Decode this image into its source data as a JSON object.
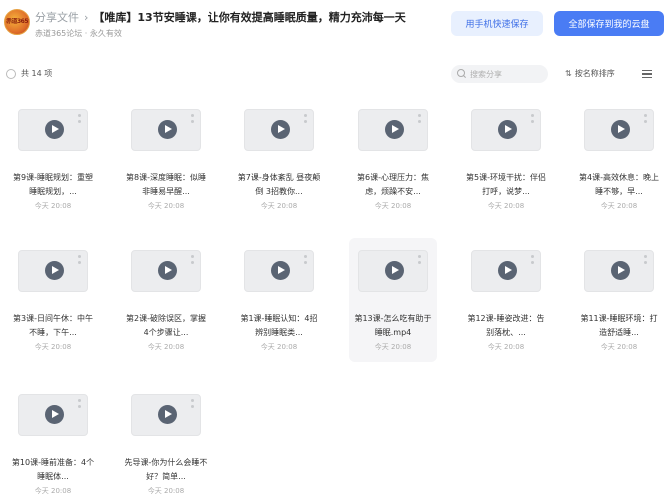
{
  "header": {
    "avatar_text": "赤道365论坛",
    "breadcrumb_root": "分享文件",
    "breadcrumb_sep": "›",
    "title": "【唯库】13节安睡课，让你有效提高睡眠质量，精力充沛每一天",
    "meta": "赤道365论坛 · 永久有效",
    "phone_save_label": "用手机快速保存",
    "save_all_label": "全部保存到我的云盘"
  },
  "toolbar": {
    "count": "共 14 项",
    "search_placeholder": "搜索分享",
    "sort_icon": "⇅",
    "sort_label": "按名称排序"
  },
  "files": [
    {
      "name": "第9课-睡眠规划：重塑睡眠规划，...",
      "date": "今天 20:08"
    },
    {
      "name": "第8课-深度睡眠：似睡非睡易早醒...",
      "date": "今天 20:08"
    },
    {
      "name": "第7课-身体紊乱 昼夜颠倒 3招教你...",
      "date": "今天 20:08"
    },
    {
      "name": "第6课-心理压力：焦虑，烦躁不安...",
      "date": "今天 20:08"
    },
    {
      "name": "第5课-环境干扰：伴侣打呼，说梦...",
      "date": "今天 20:08"
    },
    {
      "name": "第4课-高效休息：晚上睡不够，早...",
      "date": "今天 20:08"
    },
    {
      "name": "第3课-日间午休：中午不睡，下午...",
      "date": "今天 20:08"
    },
    {
      "name": "第2课-破除误区，掌握4个步骤让...",
      "date": "今天 20:08"
    },
    {
      "name": "第1课-睡眠认知：4招辨别睡眠类...",
      "date": "今天 20:08"
    },
    {
      "name": "第13课-怎么吃有助于睡眠.mp4",
      "date": "今天 20:08"
    },
    {
      "name": "第12课-睡姿改进：告别落枕、...",
      "date": "今天 20:08"
    },
    {
      "name": "第11课-睡眠环境：打造舒适睡...",
      "date": "今天 20:08"
    },
    {
      "name": "第10课-睡前准备：4个睡眠体...",
      "date": "今天 20:08"
    },
    {
      "name": "先导课-你为什么会睡不好？简单...",
      "date": "今天 20:08"
    }
  ]
}
